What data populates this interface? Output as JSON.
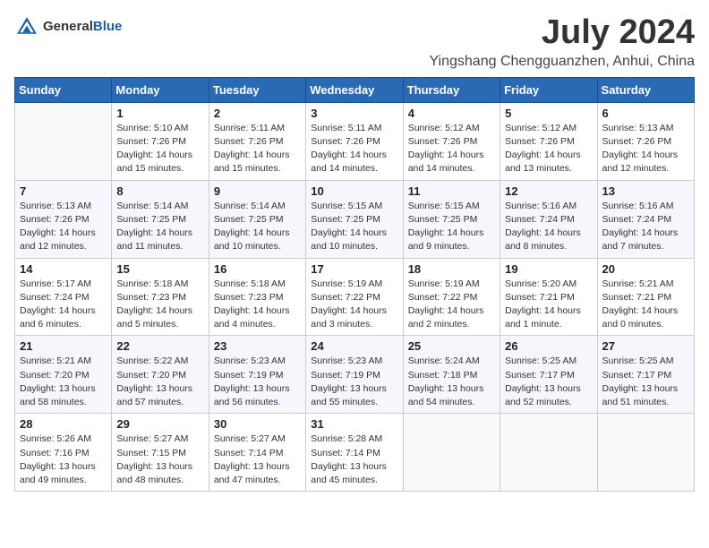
{
  "header": {
    "logo_general": "General",
    "logo_blue": "Blue",
    "month_year": "July 2024",
    "location": "Yingshang Chengguanzhen, Anhui, China"
  },
  "weekdays": [
    "Sunday",
    "Monday",
    "Tuesday",
    "Wednesday",
    "Thursday",
    "Friday",
    "Saturday"
  ],
  "weeks": [
    [
      {
        "day": "",
        "info": ""
      },
      {
        "day": "1",
        "info": "Sunrise: 5:10 AM\nSunset: 7:26 PM\nDaylight: 14 hours\nand 15 minutes."
      },
      {
        "day": "2",
        "info": "Sunrise: 5:11 AM\nSunset: 7:26 PM\nDaylight: 14 hours\nand 15 minutes."
      },
      {
        "day": "3",
        "info": "Sunrise: 5:11 AM\nSunset: 7:26 PM\nDaylight: 14 hours\nand 14 minutes."
      },
      {
        "day": "4",
        "info": "Sunrise: 5:12 AM\nSunset: 7:26 PM\nDaylight: 14 hours\nand 14 minutes."
      },
      {
        "day": "5",
        "info": "Sunrise: 5:12 AM\nSunset: 7:26 PM\nDaylight: 14 hours\nand 13 minutes."
      },
      {
        "day": "6",
        "info": "Sunrise: 5:13 AM\nSunset: 7:26 PM\nDaylight: 14 hours\nand 12 minutes."
      }
    ],
    [
      {
        "day": "7",
        "info": "Sunrise: 5:13 AM\nSunset: 7:26 PM\nDaylight: 14 hours\nand 12 minutes."
      },
      {
        "day": "8",
        "info": "Sunrise: 5:14 AM\nSunset: 7:25 PM\nDaylight: 14 hours\nand 11 minutes."
      },
      {
        "day": "9",
        "info": "Sunrise: 5:14 AM\nSunset: 7:25 PM\nDaylight: 14 hours\nand 10 minutes."
      },
      {
        "day": "10",
        "info": "Sunrise: 5:15 AM\nSunset: 7:25 PM\nDaylight: 14 hours\nand 10 minutes."
      },
      {
        "day": "11",
        "info": "Sunrise: 5:15 AM\nSunset: 7:25 PM\nDaylight: 14 hours\nand 9 minutes."
      },
      {
        "day": "12",
        "info": "Sunrise: 5:16 AM\nSunset: 7:24 PM\nDaylight: 14 hours\nand 8 minutes."
      },
      {
        "day": "13",
        "info": "Sunrise: 5:16 AM\nSunset: 7:24 PM\nDaylight: 14 hours\nand 7 minutes."
      }
    ],
    [
      {
        "day": "14",
        "info": "Sunrise: 5:17 AM\nSunset: 7:24 PM\nDaylight: 14 hours\nand 6 minutes."
      },
      {
        "day": "15",
        "info": "Sunrise: 5:18 AM\nSunset: 7:23 PM\nDaylight: 14 hours\nand 5 minutes."
      },
      {
        "day": "16",
        "info": "Sunrise: 5:18 AM\nSunset: 7:23 PM\nDaylight: 14 hours\nand 4 minutes."
      },
      {
        "day": "17",
        "info": "Sunrise: 5:19 AM\nSunset: 7:22 PM\nDaylight: 14 hours\nand 3 minutes."
      },
      {
        "day": "18",
        "info": "Sunrise: 5:19 AM\nSunset: 7:22 PM\nDaylight: 14 hours\nand 2 minutes."
      },
      {
        "day": "19",
        "info": "Sunrise: 5:20 AM\nSunset: 7:21 PM\nDaylight: 14 hours\nand 1 minute."
      },
      {
        "day": "20",
        "info": "Sunrise: 5:21 AM\nSunset: 7:21 PM\nDaylight: 14 hours\nand 0 minutes."
      }
    ],
    [
      {
        "day": "21",
        "info": "Sunrise: 5:21 AM\nSunset: 7:20 PM\nDaylight: 13 hours\nand 58 minutes."
      },
      {
        "day": "22",
        "info": "Sunrise: 5:22 AM\nSunset: 7:20 PM\nDaylight: 13 hours\nand 57 minutes."
      },
      {
        "day": "23",
        "info": "Sunrise: 5:23 AM\nSunset: 7:19 PM\nDaylight: 13 hours\nand 56 minutes."
      },
      {
        "day": "24",
        "info": "Sunrise: 5:23 AM\nSunset: 7:19 PM\nDaylight: 13 hours\nand 55 minutes."
      },
      {
        "day": "25",
        "info": "Sunrise: 5:24 AM\nSunset: 7:18 PM\nDaylight: 13 hours\nand 54 minutes."
      },
      {
        "day": "26",
        "info": "Sunrise: 5:25 AM\nSunset: 7:17 PM\nDaylight: 13 hours\nand 52 minutes."
      },
      {
        "day": "27",
        "info": "Sunrise: 5:25 AM\nSunset: 7:17 PM\nDaylight: 13 hours\nand 51 minutes."
      }
    ],
    [
      {
        "day": "28",
        "info": "Sunrise: 5:26 AM\nSunset: 7:16 PM\nDaylight: 13 hours\nand 49 minutes."
      },
      {
        "day": "29",
        "info": "Sunrise: 5:27 AM\nSunset: 7:15 PM\nDaylight: 13 hours\nand 48 minutes."
      },
      {
        "day": "30",
        "info": "Sunrise: 5:27 AM\nSunset: 7:14 PM\nDaylight: 13 hours\nand 47 minutes."
      },
      {
        "day": "31",
        "info": "Sunrise: 5:28 AM\nSunset: 7:14 PM\nDaylight: 13 hours\nand 45 minutes."
      },
      {
        "day": "",
        "info": ""
      },
      {
        "day": "",
        "info": ""
      },
      {
        "day": "",
        "info": ""
      }
    ]
  ]
}
